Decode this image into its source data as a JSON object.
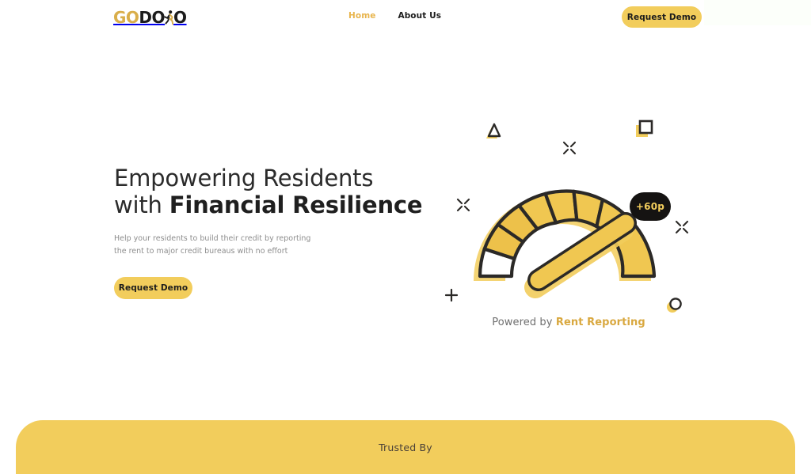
{
  "theme": {
    "brand_yellow": "#f2cd5c",
    "brand_gold": "#d9a83f",
    "ink": "#1c1c1c",
    "muted": "#8d8d8d",
    "badge_bg": "#151312"
  },
  "header": {
    "logo": {
      "part_go": "GO",
      "part_do": "DO",
      "mark_name": "running-person-mark",
      "part_tail": "O",
      "full_text": "GODOAO"
    },
    "nav": [
      {
        "label": "Home",
        "active": true
      },
      {
        "label": "About Us",
        "active": false
      }
    ],
    "cta_label": "Request Demo"
  },
  "hero": {
    "headline_line1": "Empowering Residents",
    "headline_line2_prefix": "with ",
    "headline_line2_strong": "Financial Resilience",
    "subhead": "Help your residents to build their credit by reporting the rent to major credit bureaus with no effort",
    "cta_label": "Request Demo"
  },
  "illustration": {
    "badge_label": "+60p",
    "powered_prefix": "Powered by ",
    "powered_brand": "Rent Reporting",
    "decorations": [
      {
        "name": "triangle-decoration"
      },
      {
        "name": "square-decoration"
      },
      {
        "name": "sparkle-decoration-top"
      },
      {
        "name": "sparkle-decoration-left"
      },
      {
        "name": "sparkle-decoration-right"
      },
      {
        "name": "plus-decoration"
      },
      {
        "name": "circle-decoration"
      }
    ],
    "gauge": {
      "segments": 8,
      "needle_value": "+60p"
    }
  },
  "footer": {
    "trusted_label": "Trusted By"
  }
}
